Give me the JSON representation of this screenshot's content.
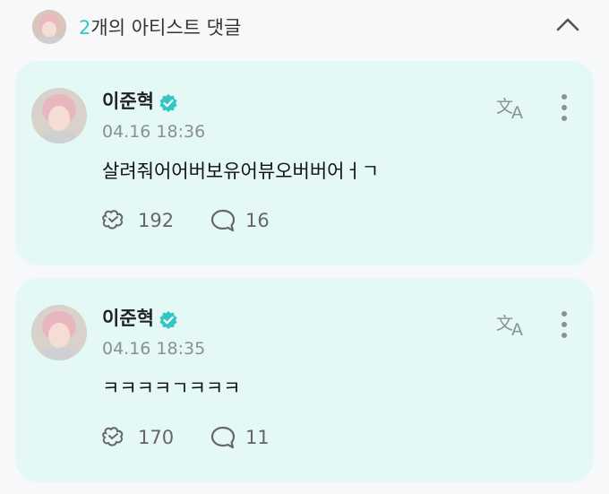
{
  "header": {
    "count": "2",
    "title_suffix": "개의 아티스트 댓글"
  },
  "comments": [
    {
      "author": "이준혁",
      "time": "04.16 18:36",
      "text": "살려줘어어버보유어뷰오버버어ㅓㄱ",
      "likes": "192",
      "replies": "16"
    },
    {
      "author": "이준혁",
      "time": "04.16 18:35",
      "text": "ㅋㅋㅋㅋㄱㅋㅋㅋ",
      "likes": "170",
      "replies": "11"
    }
  ],
  "colors": {
    "accent": "#34c6c4",
    "card_bg": "#e4f8f6",
    "page_bg": "#f7f8f9"
  },
  "icons": {
    "verified": "verified-badge-icon",
    "translate": "translate-icon",
    "more": "more-vertical-icon",
    "like": "like-icon",
    "reply": "comment-bubble-icon",
    "collapse": "chevron-up-icon"
  }
}
